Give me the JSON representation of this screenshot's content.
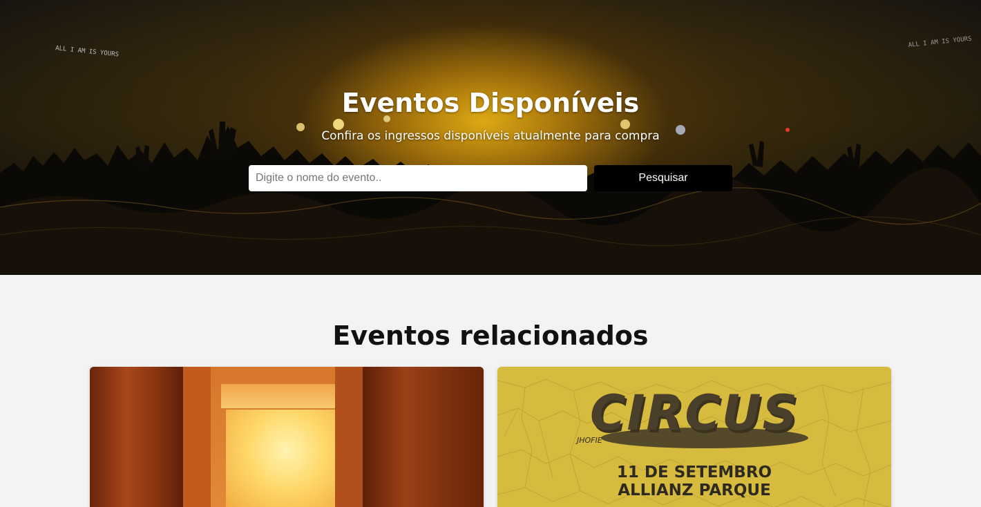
{
  "hero": {
    "title": "Eventos Disponíveis",
    "subtitle": "Confira os ingressos disponíveis atualmente para compra",
    "search": {
      "placeholder": "Digite o nome do evento..",
      "value": "",
      "button_label": "Pesquisar"
    },
    "screen_text_left": "ALL I AM IS YOURS",
    "screen_text_right": "ALL I AM IS YOURS"
  },
  "related": {
    "title": "Eventos relacionados",
    "events": [
      {
        "image": "door-glow-poster"
      },
      {
        "image": "circus-poster",
        "poster_title": "CIRCUS",
        "poster_signature": "JHOFIE",
        "date": "11 DE SETEMBRO",
        "venue": "ALLIANZ PARQUE"
      }
    ]
  },
  "colors": {
    "page_bg": "#f3f3f3",
    "button_bg": "#000000",
    "button_text": "#ffffff",
    "hero_glow": "#e6af14"
  }
}
